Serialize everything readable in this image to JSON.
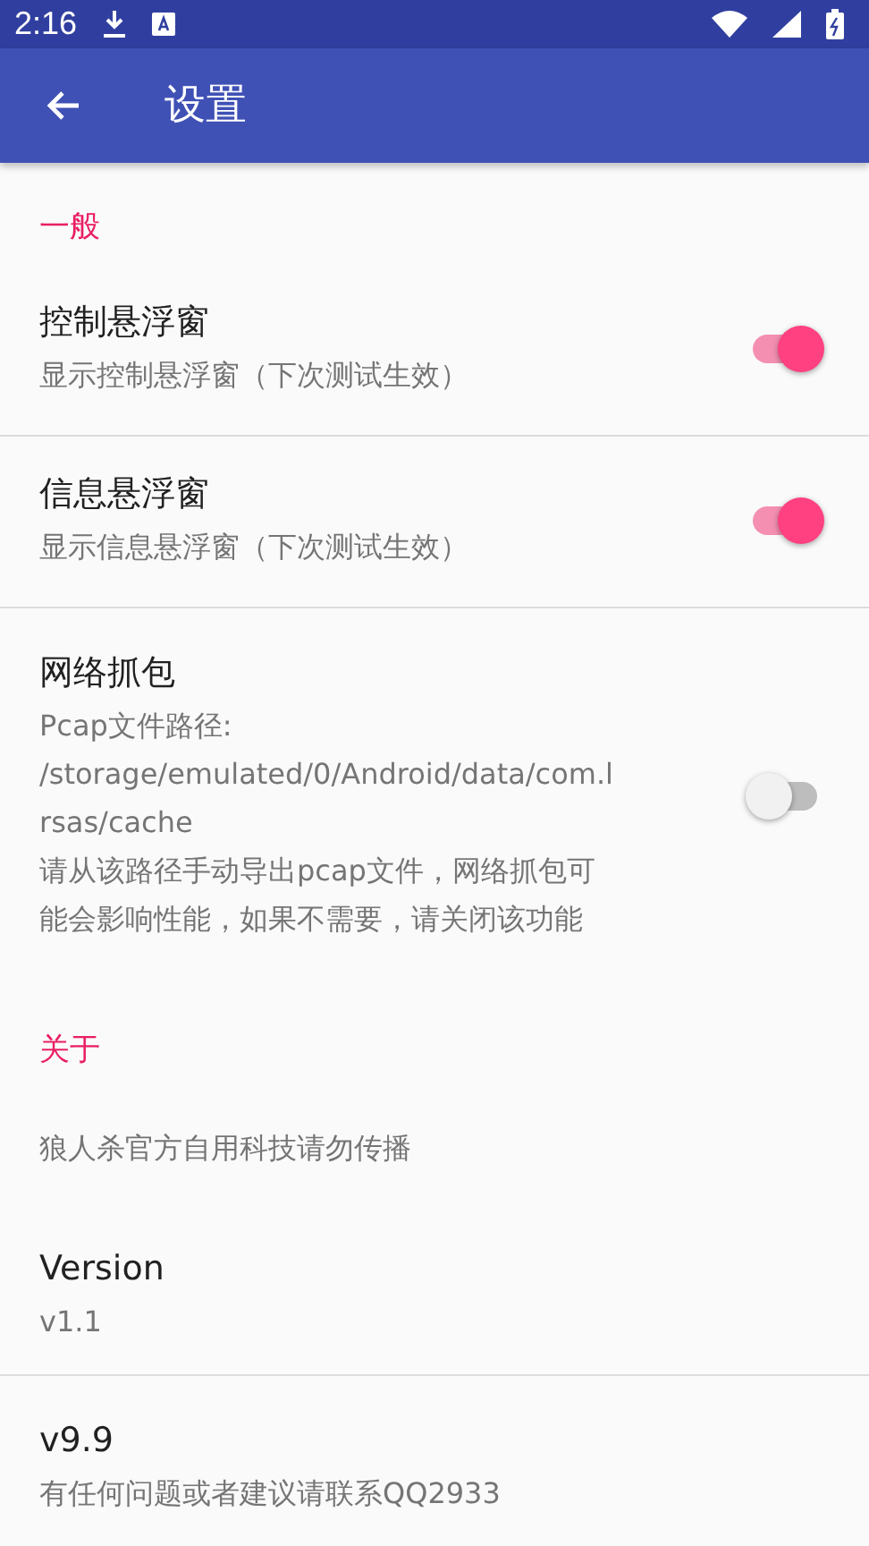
{
  "status_bar": {
    "time": "2:16"
  },
  "app_bar": {
    "title": "设置"
  },
  "sections": [
    {
      "title": "一般",
      "items": [
        {
          "kind": "switch",
          "title": "控制悬浮窗",
          "summary": "显示控制悬浮窗（下次测试生效）",
          "on": true,
          "divider": true
        },
        {
          "kind": "switch",
          "title": "信息悬浮窗",
          "summary": "显示信息悬浮窗（下次测试生效）",
          "on": true,
          "divider": true
        },
        {
          "kind": "switch",
          "title": "网络抓包",
          "summary": "Pcap文件路径: /storage/emulated/0/Android/data/com.lrsas/cache\n请从该路径手动导出pcap文件，网络抓包可能会影响性能，如果不需要，请关闭该功能",
          "on": false,
          "divider": false
        }
      ]
    },
    {
      "title": "关于",
      "items": [
        {
          "kind": "text",
          "summary": "狼人杀官方自用科技请勿传播",
          "divider": false
        },
        {
          "kind": "info",
          "title": "Version",
          "summary": "v1.1",
          "divider": true
        },
        {
          "kind": "info",
          "title": "v9.9",
          "summary": "有任何问题或者建议请联系QQ2933",
          "divider": false
        }
      ]
    }
  ]
}
